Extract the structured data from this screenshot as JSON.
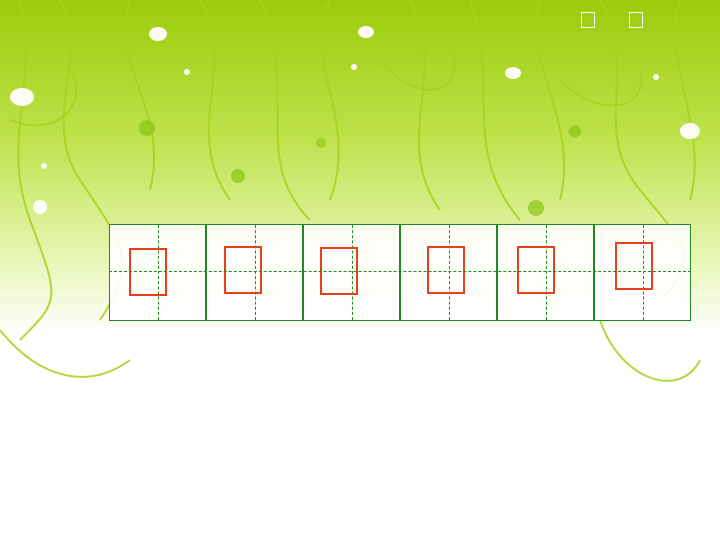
{
  "slide": {
    "background_colors": {
      "top": "#9bcc0a",
      "mid": "#d6ee8a",
      "bottom": "#ffffff"
    },
    "grid": {
      "cell_count": 6,
      "line_color": "#1f8a1f",
      "box_color": "#e8401c"
    },
    "corner_icons": [
      "missing-glyph-icon",
      "missing-glyph-icon"
    ],
    "decor_icons": [
      "leaf-icon",
      "flower-icon",
      "heart-icon",
      "swirl-vine-icon"
    ]
  }
}
